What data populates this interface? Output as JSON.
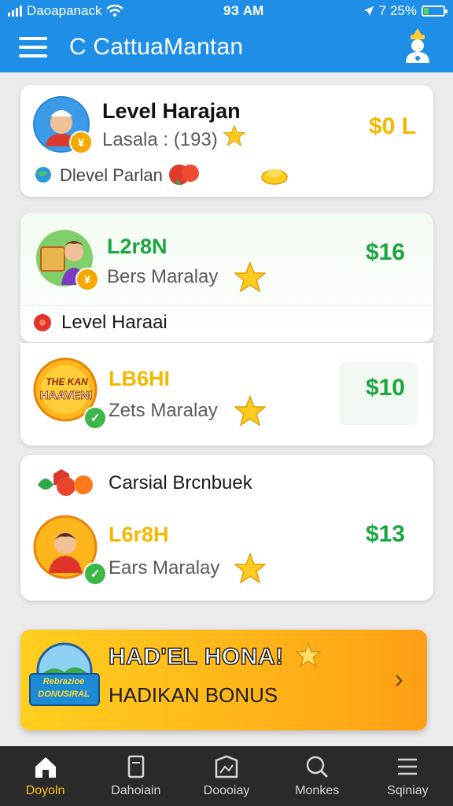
{
  "status": {
    "carrier": "Daoapanack",
    "time": "9З AM",
    "battery": "7 25%",
    "battery_level": 0.25
  },
  "header": {
    "title": "C CattuaMantan",
    "menu_icon": "hamburger-icon",
    "profile_icon": "chef-avatar-icon"
  },
  "cards": {
    "first": {
      "title": "Level Harajan",
      "subtitle": "Lasala : (193)",
      "price": "$0 L",
      "footer_label": "Dlevel Parlan"
    },
    "second": {
      "title": "L2r8N",
      "subtitle": "Bers Maralay",
      "price": "$16",
      "section_label": "Level Haraai"
    },
    "third": {
      "title": "LB6HI",
      "subtitle": "Zets Maralay",
      "price": "$10",
      "badge_text_top": "THE KAN",
      "badge_text_bottom": "HAAVENI"
    },
    "fourth": {
      "section_label": "Carsial Brcnbuek",
      "title": "L6r8H",
      "subtitle": "Ears Maralay",
      "price": "$13"
    }
  },
  "bonus": {
    "headline": "HAD'EL HONA!",
    "subline": "HADIKAN BONUS",
    "badge_line1": "Rebrazioe",
    "badge_line2": "DONUSIRAL"
  },
  "nav": [
    {
      "label": "Doyoln",
      "icon": "home-icon",
      "active": true
    },
    {
      "label": "Dahoiain",
      "icon": "document-icon",
      "active": false
    },
    {
      "label": "Doooiay",
      "icon": "frame-icon",
      "active": false
    },
    {
      "label": "Monkes",
      "icon": "search-icon",
      "active": false
    },
    {
      "label": "Sqiniay",
      "icon": "list-icon",
      "active": false
    }
  ],
  "colors": {
    "header_blue": "#1f8ee6",
    "gold": "#f5b800",
    "green": "#1aa640",
    "nav_active": "#ffc21a"
  }
}
